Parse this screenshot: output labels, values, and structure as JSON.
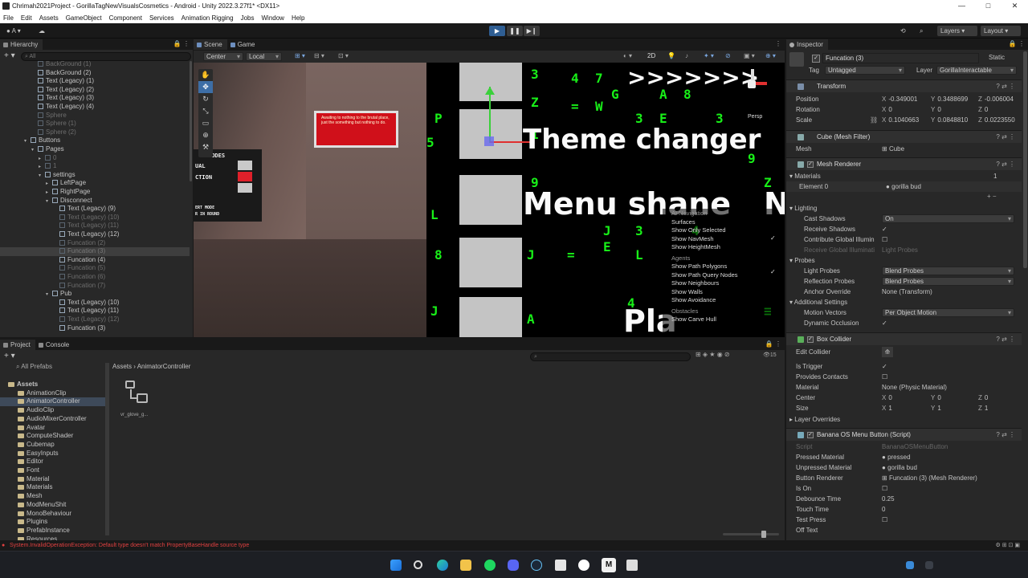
{
  "window": {
    "title": "Chrimah2021Project - GorillaTagNewVisualsCosmetics - Android - Unity 2022.3.27f1* <DX11>",
    "controls": [
      "—",
      "□",
      "✕"
    ]
  },
  "menu": [
    "File",
    "Edit",
    "Assets",
    "GameObject",
    "Component",
    "Services",
    "Animation Rigging",
    "Jobs",
    "Window",
    "Help"
  ],
  "toolbar": {
    "account": "A",
    "layers": "Layers",
    "layout": "Layout"
  },
  "hierarchy": {
    "tab": "Hierarchy",
    "search_placeholder": "All",
    "rows": [
      {
        "indent": 1,
        "text": "BackGround (1)",
        "dim": true
      },
      {
        "indent": 1,
        "text": "BackGround (2)",
        "dim": false
      },
      {
        "indent": 1,
        "text": "Text (Legacy) (1)",
        "dim": false
      },
      {
        "indent": 1,
        "text": "Text (Legacy) (2)",
        "dim": false
      },
      {
        "indent": 1,
        "text": "Text (Legacy) (3)",
        "dim": false
      },
      {
        "indent": 1,
        "text": "Text (Legacy) (4)",
        "dim": false
      },
      {
        "indent": 1,
        "text": "Sphere",
        "dim": true
      },
      {
        "indent": 1,
        "text": "Sphere (1)",
        "dim": true
      },
      {
        "indent": 1,
        "text": "Sphere (2)",
        "dim": true
      },
      {
        "indent": 0,
        "text": "Buttons",
        "dim": false,
        "arrow": "▾"
      },
      {
        "indent": 1,
        "text": "Pages",
        "dim": false,
        "arrow": "▾"
      },
      {
        "indent": 2,
        "text": "0",
        "dim": true,
        "arrow": "▸"
      },
      {
        "indent": 2,
        "text": "1",
        "dim": true,
        "arrow": "▸"
      },
      {
        "indent": 2,
        "text": "settings",
        "dim": false,
        "arrow": "▾"
      },
      {
        "indent": 3,
        "text": "LeftPage",
        "dim": false,
        "arrow": "▸"
      },
      {
        "indent": 3,
        "text": "RightPage",
        "dim": false,
        "arrow": "▸"
      },
      {
        "indent": 3,
        "text": "Disconnect",
        "dim": false,
        "arrow": "▾"
      },
      {
        "indent": 4,
        "text": "Text (Legacy) (9)",
        "dim": false
      },
      {
        "indent": 4,
        "text": "Text (Legacy) (10)",
        "dim": true
      },
      {
        "indent": 4,
        "text": "Text (Legacy) (11)",
        "dim": true
      },
      {
        "indent": 4,
        "text": "Text (Legacy) (12)",
        "dim": false
      },
      {
        "indent": 4,
        "text": "Funcation (2)",
        "dim": true
      },
      {
        "indent": 4,
        "text": "Funcation (3)",
        "dim": true,
        "selected": true
      },
      {
        "indent": 4,
        "text": "Funcation (4)",
        "dim": false
      },
      {
        "indent": 4,
        "text": "Funcation (5)",
        "dim": true
      },
      {
        "indent": 4,
        "text": "Funcation (6)",
        "dim": true
      },
      {
        "indent": 4,
        "text": "Funcation (7)",
        "dim": true
      },
      {
        "indent": 3,
        "text": "Pub",
        "dim": false,
        "arrow": "▾"
      },
      {
        "indent": 4,
        "text": "Text (Legacy) (10)",
        "dim": false
      },
      {
        "indent": 4,
        "text": "Text (Legacy) (11)",
        "dim": false
      },
      {
        "indent": 4,
        "text": "Text (Legacy) (12)",
        "dim": true
      },
      {
        "indent": 4,
        "text": "Funcation (3)",
        "dim": false
      }
    ]
  },
  "scene": {
    "tabs": [
      "Scene",
      "Game"
    ],
    "pivot": "Center",
    "space": "Local",
    "mode_2d": "2D",
    "persp": "Persp",
    "sign_text": "Awaiting to nothing to the brutal place, just the something but nothing to do.",
    "left_panel_lines": [
      "MODES",
      "UAL",
      "CTION",
      "ERT MODE",
      "R IN ROUND"
    ],
    "big_texts": [
      "Theme changer",
      "Menu shane",
      "Pla",
      ">>>>>>>",
      "N"
    ],
    "gizmo_menu": {
      "sections": [
        {
          "header": "AI Navigation",
          "items": [
            "Surfaces",
            "Show Only Selected",
            "Show NavMesh",
            "Show HeightMesh"
          ]
        },
        {
          "header": "Agents",
          "items": [
            "Show Path Polygons",
            "Show Path Query Nodes",
            "Show Neighbours",
            "Show Walls",
            "Show Avoidance"
          ]
        },
        {
          "header": "Obstacles",
          "items": [
            "Show Carve Hull"
          ]
        }
      ]
    }
  },
  "inspector": {
    "tab": "Inspector",
    "object_name": "Funcation (3)",
    "static_label": "Static",
    "tag_label": "Tag",
    "tag_value": "Untagged",
    "layer_label": "Layer",
    "layer_value": "GorillaInteractable",
    "transform": {
      "title": "Transform",
      "position_label": "Position",
      "position": [
        "-0.349001",
        "0.3488699",
        "-0.006004"
      ],
      "rotation_label": "Rotation",
      "rotation": [
        "0",
        "0",
        "0"
      ],
      "scale_label": "Scale",
      "scale": [
        "0.1040663",
        "0.0848810",
        "0.0223550"
      ]
    },
    "mesh_filter": {
      "title": "Cube (Mesh Filter)",
      "mesh_label": "Mesh",
      "mesh_value": "Cube"
    },
    "mesh_renderer": {
      "title": "Mesh Renderer",
      "materials_label": "Materials",
      "materials_count": "1",
      "element0_label": "Element 0",
      "element0_value": "gorilla bud",
      "lighting": "Lighting",
      "cast_shadows_label": "Cast Shadows",
      "cast_shadows": "On",
      "receive_shadows_label": "Receive Shadows",
      "contribute_gi_label": "Contribute Global Illumin",
      "receive_gi_label": "Receive Global Illuminati",
      "receive_gi": "Light Probes",
      "probes": "Probes",
      "light_probes_label": "Light Probes",
      "light_probes": "Blend Probes",
      "reflection_probes_label": "Reflection Probes",
      "reflection_probes": "Blend Probes",
      "anchor_override_label": "Anchor Override",
      "anchor_override": "None (Transform)",
      "additional": "Additional Settings",
      "motion_vectors_label": "Motion Vectors",
      "motion_vectors": "Per Object Motion",
      "dynamic_occlusion_label": "Dynamic Occlusion"
    },
    "box_collider": {
      "title": "Box Collider",
      "edit_collider_label": "Edit Collider",
      "is_trigger_label": "Is Trigger",
      "provides_contacts_label": "Provides Contacts",
      "material_label": "Material",
      "material": "None (Physic Material)",
      "center_label": "Center",
      "center": [
        "0",
        "0",
        "0"
      ],
      "size_label": "Size",
      "size": [
        "1",
        "1",
        "1"
      ],
      "layer_overrides": "Layer Overrides"
    },
    "script": {
      "title": "Banana OS Menu Button (Script)",
      "script_label": "Script",
      "script_value": "BananaOSMenuButton",
      "pressed_label": "Pressed Material",
      "pressed": "pressed",
      "unpressed_label": "Unpressed Material",
      "unpressed": "gorilla bud",
      "renderer_label": "Button Renderer",
      "renderer": "Funcation (3) (Mesh Renderer)",
      "is_on_label": "Is On",
      "debounce_label": "Debounce Time",
      "debounce": "0.25",
      "touch_label": "Touch Time",
      "touch": "0",
      "test_press_label": "Test Press",
      "off_text_label": "Off Text"
    }
  },
  "project": {
    "tabs": [
      "Project",
      "Console"
    ],
    "favorites_item": "All Prefabs",
    "breadcrumb": [
      "Assets",
      "AnimatorController"
    ],
    "count": "15",
    "asset_name": "vr_glove_g...",
    "tree": [
      {
        "text": "Assets",
        "bold": true
      },
      {
        "text": "AnimationClip"
      },
      {
        "text": "AnimatorController",
        "selected": true
      },
      {
        "text": "AudioClip"
      },
      {
        "text": "AudioMixerController"
      },
      {
        "text": "Avatar"
      },
      {
        "text": "ComputeShader"
      },
      {
        "text": "Cubemap"
      },
      {
        "text": "EasyInputs"
      },
      {
        "text": "Editor"
      },
      {
        "text": "Font"
      },
      {
        "text": "Material"
      },
      {
        "text": "Materials"
      },
      {
        "text": "Mesh"
      },
      {
        "text": "ModMenuShit"
      },
      {
        "text": "MonoBehaviour"
      },
      {
        "text": "Plugins"
      },
      {
        "text": "PrefabInstance"
      },
      {
        "text": "Resources"
      }
    ]
  },
  "status": {
    "error": "System.InvalidOperationException: Default type doesn't match PropertyBaseHandle source type"
  },
  "colors": {
    "matrix_green": "#18f018",
    "sign_red": "#d0101a",
    "error_red": "#e04040"
  }
}
